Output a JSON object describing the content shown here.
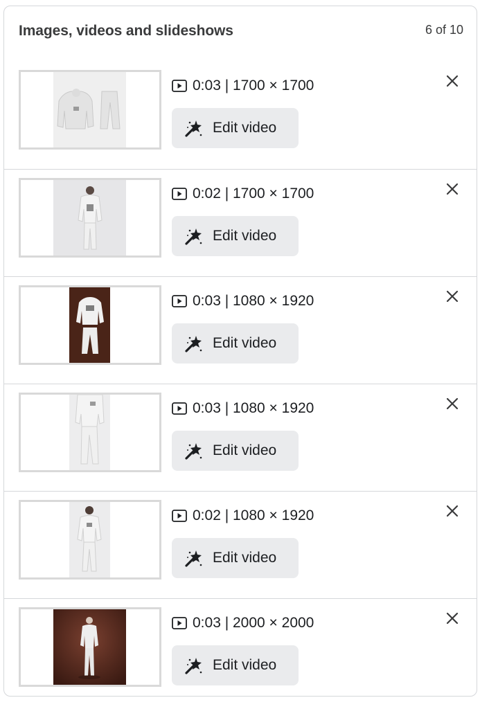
{
  "panel": {
    "title": "Images, videos and slideshows",
    "count": "6 of 10"
  },
  "items": [
    {
      "meta": "0:03 | 1700 × 1700",
      "edit_label": "Edit video",
      "thumb_icon": "outfit-flatlay-thumbnail"
    },
    {
      "meta": "0:02 | 1700 × 1700",
      "edit_label": "Edit video",
      "thumb_icon": "model-back-view-thumbnail"
    },
    {
      "meta": "0:03 | 1080 × 1920",
      "edit_label": "Edit video",
      "thumb_icon": "outfit-on-brown-thumbnail"
    },
    {
      "meta": "0:03 | 1080 × 1920",
      "edit_label": "Edit video",
      "thumb_icon": "model-legs-thumbnail"
    },
    {
      "meta": "0:02 | 1080 × 1920",
      "edit_label": "Edit video",
      "thumb_icon": "model-front-thumbnail"
    },
    {
      "meta": "0:03 | 2000 × 2000",
      "edit_label": "Edit video",
      "thumb_icon": "model-brown-studio-thumbnail"
    }
  ],
  "colors": {
    "button_bg": "#eaebed",
    "border": "#d5d7da",
    "thumb_border": "#d9d9d9",
    "text": "#1c1e21"
  }
}
